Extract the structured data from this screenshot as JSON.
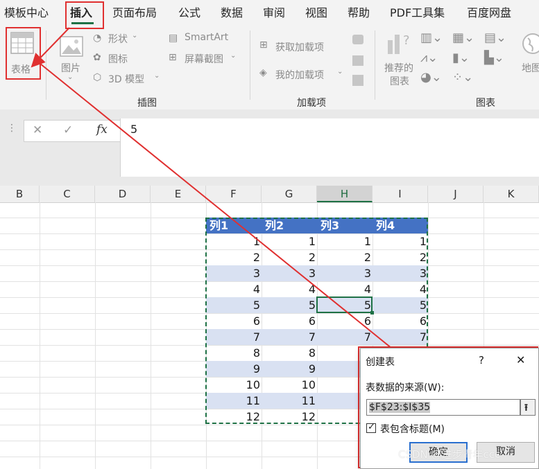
{
  "menu": {
    "tabs": [
      "模板中心",
      "插入",
      "页面布局",
      "公式",
      "数据",
      "审阅",
      "视图",
      "帮助",
      "PDF工具集",
      "百度网盘"
    ],
    "active_tab": "插入"
  },
  "ribbon": {
    "table_label": "表格",
    "picture_label": "图片",
    "shapes_label": "形状",
    "icons_label": "图标",
    "model3d_label": "3D 模型",
    "smartart_label": "SmartArt",
    "screenshot_label": "屏幕截图",
    "get_addins_label": "获取加载项",
    "my_addins_label": "我的加载项",
    "recommended_charts_label_1": "推荐的",
    "recommended_charts_label_2": "图表",
    "maps_label": "地图",
    "group_illustrations": "插图",
    "group_addins": "加载项",
    "group_charts": "图表"
  },
  "formula_bar": {
    "cancel_glyph": "✕",
    "enter_glyph": "✓",
    "fx_label": "fx",
    "value": "5"
  },
  "columns": [
    "B",
    "C",
    "D",
    "E",
    "F",
    "G",
    "H",
    "I",
    "J",
    "K"
  ],
  "selected_column": "H",
  "table": {
    "headers": [
      "列1",
      "列2",
      "列3",
      "列4"
    ],
    "rows": [
      [
        "1",
        "1",
        "1",
        "1"
      ],
      [
        "2",
        "2",
        "2",
        "2"
      ],
      [
        "3",
        "3",
        "3",
        "3"
      ],
      [
        "4",
        "4",
        "4",
        "4"
      ],
      [
        "5",
        "5",
        "5",
        "5"
      ],
      [
        "6",
        "6",
        "6",
        "6"
      ],
      [
        "7",
        "7",
        "7",
        "7"
      ],
      [
        "8",
        "8",
        "",
        ""
      ],
      [
        "9",
        "9",
        "",
        ""
      ],
      [
        "10",
        "10",
        "",
        ""
      ],
      [
        "11",
        "11",
        "",
        ""
      ],
      [
        "12",
        "12",
        "",
        ""
      ]
    ]
  },
  "dialog": {
    "title": "创建表",
    "help": "?",
    "close": "✕",
    "source_label": "表数据的来源(W):",
    "range_value": "$F$23:$I$35",
    "has_headers_label": "表包含标题(M)",
    "has_headers_checked": true,
    "ok_label": "确定",
    "cancel_label": "取消"
  },
  "watermark": "CSDN @进步青年ccc",
  "colors": {
    "header_blue": "#4472c4",
    "band_blue": "#d9e1f2",
    "excel_green": "#1e7145",
    "annotation_red": "#e03030"
  },
  "icons": [
    "table-icon",
    "picture-icon",
    "shapes-icon",
    "icons-icon",
    "3d-model-icon",
    "smartart-icon",
    "screenshot-icon",
    "get-addins-icon",
    "my-addins-icon",
    "recommended-charts-icon",
    "maps-icon"
  ]
}
